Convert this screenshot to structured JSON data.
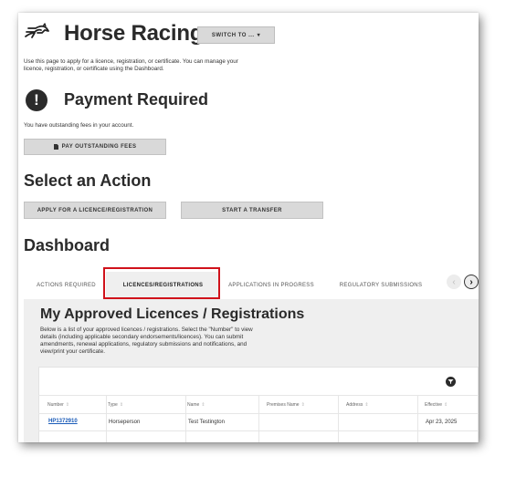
{
  "header": {
    "app_title": "Horse Racing",
    "switch_label": "SWITCH TO ...",
    "switch_caret": "▾",
    "intro": "Use this page to apply for a licence, registration, or certificate. You can manage your licence, registration, or certificate using the Dashboard."
  },
  "payment": {
    "icon": "!",
    "title": "Payment Required",
    "text": "You have outstanding fees in your account.",
    "button_label": "PAY OUTSTANDING FEES"
  },
  "actions": {
    "title": "Select an Action",
    "apply_label": "APPLY FOR A LICENCE/REGISTRATION",
    "transfer_label": "START A TRANSFER"
  },
  "dashboard": {
    "title": "Dashboard",
    "tabs": [
      {
        "label": "ACTIONS REQUIRED"
      },
      {
        "label": "LICENCES/REGISTRATIONS"
      },
      {
        "label": "APPLICATIONS IN PROGRESS"
      },
      {
        "label": "REGULATORY SUBMISSIONS"
      }
    ],
    "active_tab": "LICENCES/REGISTRATIONS",
    "prev_arrow": "‹",
    "next_arrow": "›"
  },
  "panel": {
    "title": "My Approved Licences / Registrations",
    "description": "Below is a list of your approved licences / registrations. Select the \"Number\" to view details (including applicable secondary endorsements/licences). You can submit amendments, renewal applications, regulatory submissions and notifications, and view/print your certificate."
  },
  "table": {
    "sort_glyph": "⇕",
    "columns": [
      "Number",
      "Type",
      "Name",
      "Premises Name",
      "Address",
      "Effective"
    ],
    "rows": [
      {
        "number": "HP1372910",
        "type": "Horseperson",
        "name": "Test Testington",
        "premises": "",
        "address": "",
        "effective": "Apr 23, 2025"
      }
    ]
  },
  "colors": {
    "highlight": "#d0121b",
    "link": "#1a5bb8",
    "button_bg": "#d9d9d9",
    "panel_bg": "#efefef"
  },
  "icons": [
    "horse-logo-icon",
    "chevron-down-icon",
    "exclamation-icon",
    "document-icon",
    "chevron-left-icon",
    "chevron-right-icon",
    "filter-icon",
    "sort-icon"
  ]
}
